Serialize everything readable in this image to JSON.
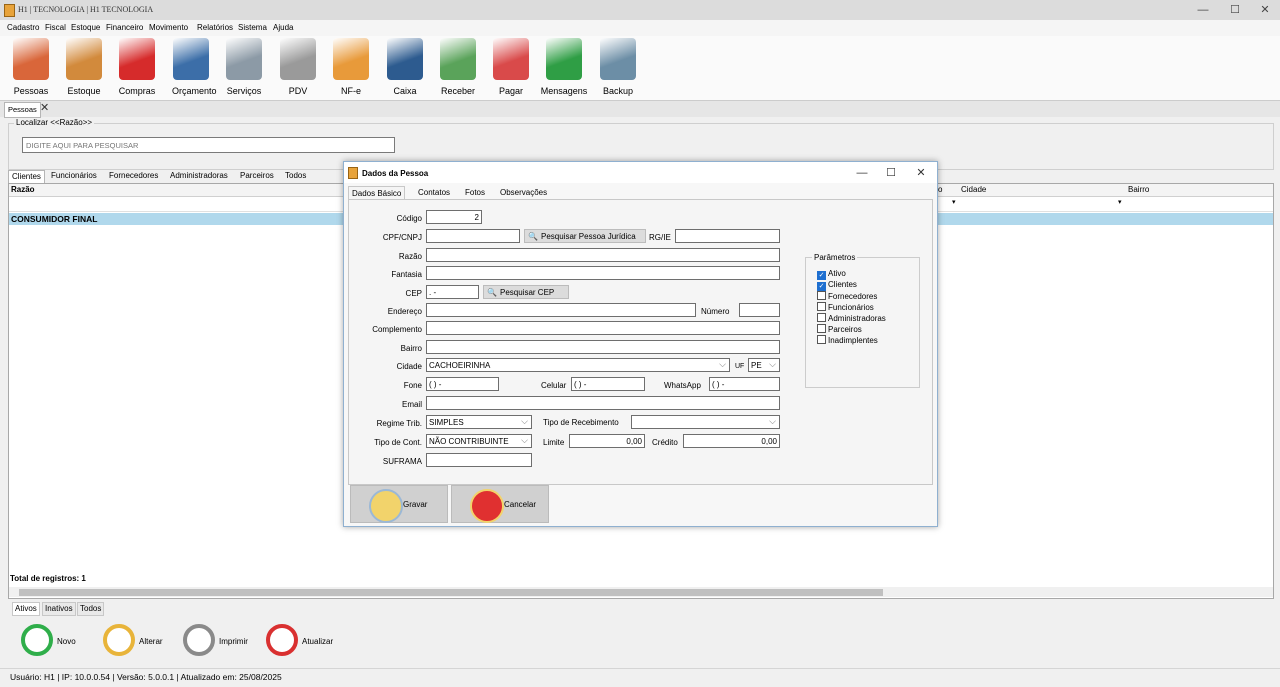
{
  "window": {
    "title": "H1 | TECNOLOGIA | H1 TECNOLOGIA",
    "minimize": "—",
    "maximize": "☐",
    "close": "✕"
  },
  "menu": [
    "Cadastro",
    "Fiscal",
    "Estoque",
    "Financeiro",
    "Movimento",
    "Relatórios",
    "Sistema",
    "Ajuda"
  ],
  "toolbar": [
    {
      "label": "Pessoas",
      "icon": "person-icon",
      "color": "#d9663a"
    },
    {
      "label": "Estoque",
      "icon": "box-icon",
      "color": "#d28a3c"
    },
    {
      "label": "Compras",
      "icon": "basket-icon",
      "color": "#d62b2b"
    },
    {
      "label": "Orçamento",
      "icon": "calculator-icon",
      "color": "#3c6ea8"
    },
    {
      "label": "Serviços",
      "icon": "tools-icon",
      "color": "#8c9aa6"
    },
    {
      "label": "PDV",
      "icon": "register-icon",
      "color": "#9a9a9a"
    },
    {
      "label": "NF-e",
      "icon": "document-icon",
      "color": "#e89a3a"
    },
    {
      "label": "Caixa",
      "icon": "cash-book-icon",
      "color": "#2d5b8f"
    },
    {
      "label": "Receber",
      "icon": "receive-money-icon",
      "color": "#5aa35a"
    },
    {
      "label": "Pagar",
      "icon": "pay-money-icon",
      "color": "#d94a4a"
    },
    {
      "label": "Mensagens",
      "icon": "whatsapp-icon",
      "color": "#2f9e45"
    },
    {
      "label": "Backup",
      "icon": "usb-drive-icon",
      "color": "#6c8ea6"
    }
  ],
  "doc_tab": {
    "label": "Pessoas",
    "close": "✕"
  },
  "locate": {
    "label": "Localizar <<Razão>>",
    "placeholder": "DIGITE AQUI PARA PESQUISAR"
  },
  "category_tabs": [
    "Clientes",
    "Funcionários",
    "Fornecedores",
    "Administradoras",
    "Parceiros",
    "Todos"
  ],
  "grid": {
    "columns": [
      "Razão",
      "o",
      "Cidade",
      "Bairro"
    ],
    "rows": [
      [
        "CONSUMIDOR FINAL"
      ]
    ],
    "total": "Total de registros: 1"
  },
  "status_tabs": [
    "Ativos",
    "Inativos",
    "Todos"
  ],
  "actions": [
    {
      "label": "Novo",
      "icon": "add-icon",
      "color": "#2fae4a"
    },
    {
      "label": "Alterar",
      "icon": "edit-icon",
      "color": "#e8b43a"
    },
    {
      "label": "Imprimir",
      "icon": "printer-icon",
      "color": "#8a8a8a"
    },
    {
      "label": "Atualizar",
      "icon": "refresh-icon",
      "color": "#d93030"
    }
  ],
  "statusbar": "Usuário: H1 | IP: 10.0.0.54 | Versão: 5.0.0.1 | Atualizado em: 25/08/2025",
  "dialog": {
    "title": "Dados da Pessoa",
    "tabs": [
      "Dados Básico",
      "Contatos",
      "Fotos",
      "Observações"
    ],
    "labels": {
      "codigo": "Código",
      "cpf": "CPF/CNPJ",
      "razao": "Razão",
      "fantasia": "Fantasia",
      "cep": "CEP",
      "endereco": "Endereço",
      "numero": "Número",
      "complemento": "Complemento",
      "bairro": "Bairro",
      "cidade": "Cidade",
      "uf": "UF",
      "fone": "Fone",
      "celular": "Celular",
      "whatsapp": "WhatsApp",
      "email": "Email",
      "regime": "Regime Trib.",
      "tipo_receb": "Tipo de Recebimento",
      "tipo_cont": "Tipo de Cont.",
      "limite": "Limite",
      "credito": "Crédito",
      "suframa": "SUFRAMA",
      "rgie": "RG/IE"
    },
    "values": {
      "codigo": "2",
      "cep": ".    -",
      "cidade": "CACHOEIRINHA",
      "uf": "PE",
      "fone": "(  )      -",
      "celular": "(  )      -",
      "whatsapp": "(  )      -",
      "regime": "SIMPLES",
      "tipo_cont": "NÃO CONTRIBUINTE",
      "limite": "0,00",
      "credito": "0,00"
    },
    "buttons": {
      "pesquisar_pj": "Pesquisar Pessoa Jurídica",
      "pesquisar_cep": "Pesquisar CEP",
      "gravar": "Gravar",
      "cancelar": "Cancelar"
    },
    "params": {
      "title": "Parâmetros",
      "items": [
        {
          "label": "Ativo",
          "checked": true
        },
        {
          "label": "Clientes",
          "checked": true
        },
        {
          "label": "Fornecedores",
          "checked": false
        },
        {
          "label": "Funcionários",
          "checked": false
        },
        {
          "label": "Administradoras",
          "checked": false
        },
        {
          "label": "Parceiros",
          "checked": false
        },
        {
          "label": "Inadimplentes",
          "checked": false
        }
      ]
    }
  }
}
